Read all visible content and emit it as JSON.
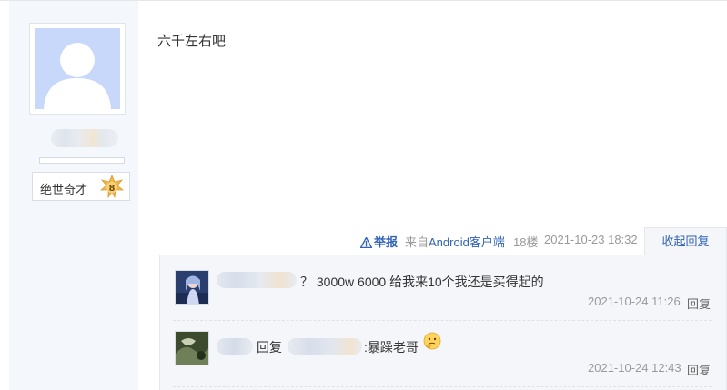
{
  "post": {
    "content": "六千左右吧",
    "author": {
      "badge_title": "绝世奇才",
      "badge_level": "8"
    },
    "footer": {
      "report_label": "举报",
      "client_prefix": "来自",
      "client_name": "Android客户端",
      "floor": "18楼",
      "timestamp": "2021-10-23 18:32",
      "collapse_label": "收起回复"
    }
  },
  "replies": [
    {
      "text": "？ 3000w 6000 给我来10个我还是买得起的",
      "timestamp": "2021-10-24 11:26",
      "reply_label": "回复"
    },
    {
      "reply_word": "回复",
      "text": ":暴躁老哥",
      "emoji": "thinking-face",
      "timestamp": "2021-10-24 12:43",
      "reply_label": "回复"
    }
  ],
  "colors": {
    "link_blue": "#3163b6",
    "sidebar_bg": "#f4f7fb",
    "reply_bg": "#f4f6f9",
    "avatar_placeholder": "#c8d8fa",
    "badge_star": "#f0b84a"
  }
}
